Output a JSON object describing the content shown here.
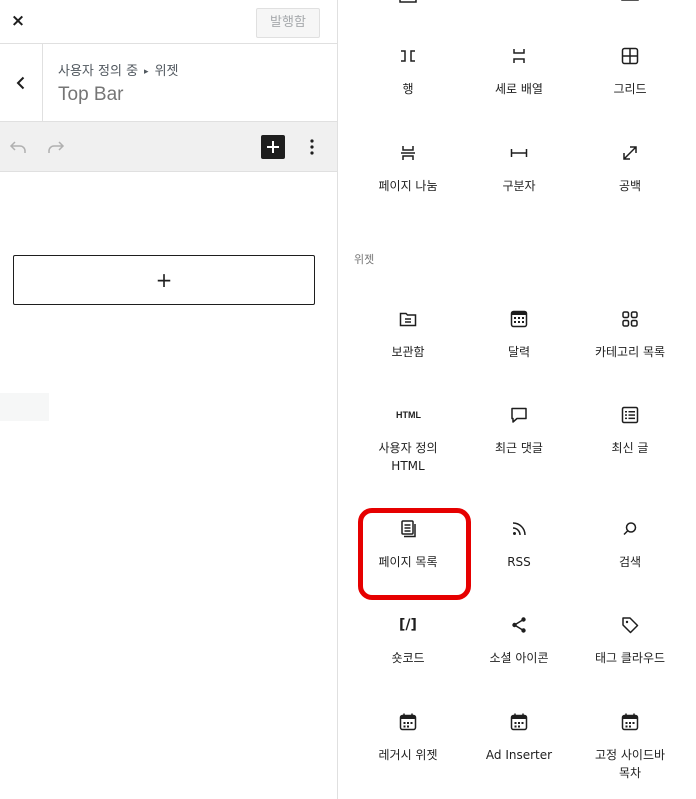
{
  "header": {
    "close_label": "×",
    "publish_label": "발행함"
  },
  "breadcrumb": {
    "parent": "사용자 정의 중",
    "separator": "▸",
    "current": "위젯",
    "area_title": "Top Bar"
  },
  "editor": {
    "add_block_label": "+"
  },
  "inserter": {
    "widgets_heading": "위젯",
    "layout_blocks": [
      {
        "label": "행",
        "icon": "row-icon"
      },
      {
        "label": "세로 배열",
        "icon": "stack-icon"
      },
      {
        "label": "그리드",
        "icon": "grid-icon"
      },
      {
        "label": "페이지 나눔",
        "icon": "page-break-icon"
      },
      {
        "label": "구분자",
        "icon": "separator-icon"
      },
      {
        "label": "공백",
        "icon": "spacer-icon"
      }
    ],
    "widget_blocks": [
      {
        "label": "보관함",
        "icon": "archive-icon"
      },
      {
        "label": "달력",
        "icon": "calendar-icon"
      },
      {
        "label": "카테고리 목록",
        "icon": "categories-icon"
      },
      {
        "label": "사용자 정의 HTML",
        "icon": "html-icon",
        "icon_text": "HTML"
      },
      {
        "label": "최근 댓글",
        "icon": "comment-icon"
      },
      {
        "label": "최신 글",
        "icon": "latest-posts-icon"
      },
      {
        "label": "페이지 목록",
        "icon": "page-list-icon"
      },
      {
        "label": "RSS",
        "icon": "rss-icon"
      },
      {
        "label": "검색",
        "icon": "search-icon"
      },
      {
        "label": "숏코드",
        "icon": "shortcode-icon",
        "icon_text": "[/]"
      },
      {
        "label": "소셜 아이콘",
        "icon": "share-icon"
      },
      {
        "label": "태그 클라우드",
        "icon": "tag-icon"
      },
      {
        "label": "레거시 위젯",
        "icon": "legacy-widget-icon"
      },
      {
        "label": "Ad Inserter",
        "icon": "ad-inserter-icon"
      },
      {
        "label": "고정 사이드바 목차",
        "icon": "sidebar-toc-icon"
      }
    ]
  },
  "colors": {
    "highlight": "#e60000",
    "text": "#1e1e1e",
    "muted": "#757575"
  }
}
